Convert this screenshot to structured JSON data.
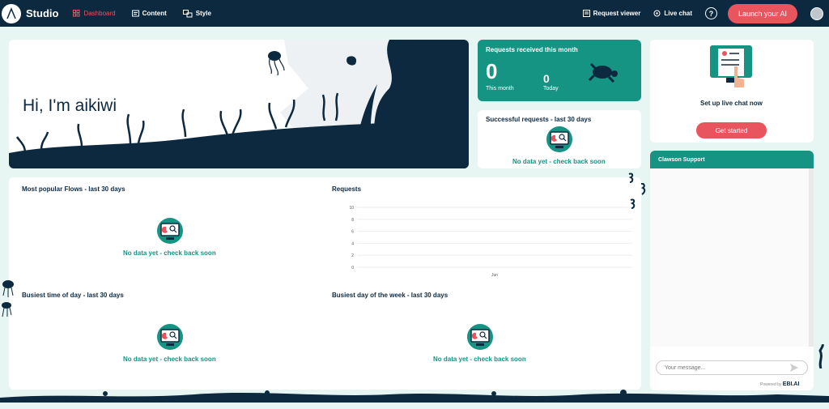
{
  "topbar": {
    "brand": "Studio",
    "nav": [
      {
        "label": "Dashboard",
        "icon": "dashboard-icon",
        "active": true
      },
      {
        "label": "Content",
        "icon": "content-icon"
      },
      {
        "label": "Style",
        "icon": "style-icon"
      }
    ],
    "right": [
      {
        "label": "Request viewer",
        "icon": "request-viewer-icon"
      },
      {
        "label": "Live chat",
        "icon": "live-chat-icon"
      }
    ],
    "help_glyph": "?",
    "launch_label": "Launch your AI"
  },
  "hero": {
    "greeting": "Hi, I'm aikiwi"
  },
  "requests_month": {
    "title": "Requests received this month",
    "this_month_value": "0",
    "this_month_label": "This month",
    "today_value": "0",
    "today_label": "Today"
  },
  "successful": {
    "title": "Successful requests - last 30 days",
    "nodata": "No data yet - check back soon"
  },
  "live_chat_card": {
    "label": "Set up live chat now",
    "button": "Get started"
  },
  "popular_flows": {
    "title": "Most popular Flows - last 30 days",
    "nodata": "No data yet - check back soon"
  },
  "requests_chart": {
    "title": "Requests"
  },
  "busiest_time": {
    "title": "Busiest time of day - last 30 days",
    "nodata": "No data yet - check back soon"
  },
  "busiest_day": {
    "title": "Busiest day of the week - last 30 days",
    "nodata": "No data yet - check back soon"
  },
  "chat": {
    "header": "Clawson Support",
    "placeholder": "Your message...",
    "powered_by": "Powered by",
    "powered_brand": "EBI.AI"
  },
  "colors": {
    "navy": "#0d2940",
    "teal": "#159383",
    "coral": "#e8555f",
    "background": "#e8f6f3"
  },
  "chart_data": {
    "type": "line",
    "title": "Requests",
    "categories": [
      "Jun"
    ],
    "series": [
      {
        "values": []
      }
    ],
    "yticks": [
      0,
      2,
      4,
      6,
      8,
      10
    ],
    "ylim": [
      0,
      10
    ],
    "grid": true
  }
}
